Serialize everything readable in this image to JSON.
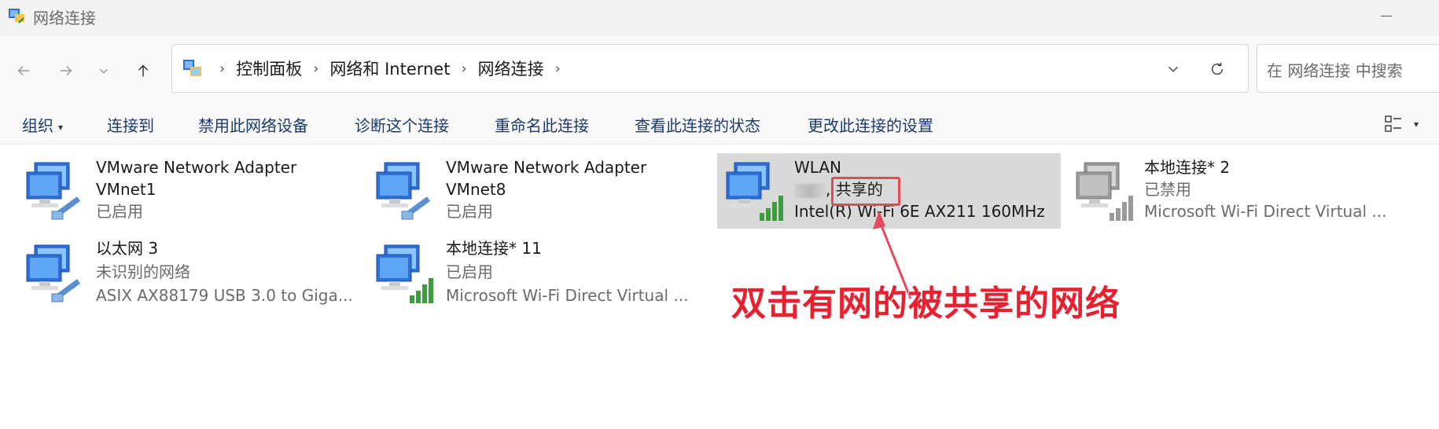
{
  "window": {
    "title": "网络连接"
  },
  "address": {
    "breadcrumbs": [
      "控制面板",
      "网络和 Internet",
      "网络连接"
    ],
    "search_placeholder": "在 网络连接 中搜索"
  },
  "toolbar": {
    "organize": "组织",
    "connect_to": "连接到",
    "disable_device": "禁用此网络设备",
    "diagnose": "诊断这个连接",
    "rename": "重命名此连接",
    "view_status": "查看此连接的状态",
    "change_settings": "更改此连接的设置"
  },
  "connections": [
    {
      "name1": "VMware Network Adapter",
      "name2": "VMnet1",
      "status": "已启用",
      "icon": "ethernet-network-icon"
    },
    {
      "name1": "VMware Network Adapter",
      "name2": "VMnet8",
      "status": "已启用",
      "icon": "ethernet-network-icon"
    },
    {
      "name1": "WLAN",
      "status": ", 共享的",
      "device": "Intel(R) Wi-Fi 6E AX211 160MHz",
      "icon": "wifi-network-icon"
    },
    {
      "name1": "本地连接* 2",
      "status": "已禁用",
      "device": "Microsoft Wi-Fi Direct Virtual ...",
      "icon": "wifi-network-disabled-icon"
    },
    {
      "name1": "以太网 3",
      "status": "未识别的网络",
      "device": "ASIX AX88179 USB 3.0 to Giga...",
      "icon": "ethernet-network-icon"
    },
    {
      "name1": "本地连接* 11",
      "status": "已启用",
      "device": "Microsoft Wi-Fi Direct Virtual ...",
      "icon": "wifi-network-icon"
    }
  ],
  "annotation": {
    "text": "双击有网的被共享的网络"
  },
  "colors": {
    "annotation": "#e8202f",
    "selected": "#d9d9d9",
    "command": "#1a3a6b"
  }
}
